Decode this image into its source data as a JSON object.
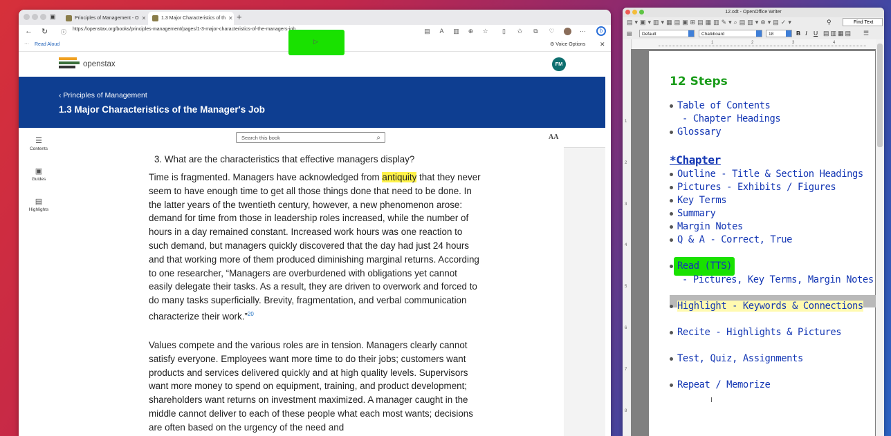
{
  "browser": {
    "tabs": [
      {
        "label": "Principles of Management - O"
      },
      {
        "label": "1.3 Major Characteristics of th"
      }
    ],
    "url": "https://openstax.org/books/principles-management/pages/1-3-major-characteristics-of-the-managers-job",
    "read_aloud": "Read Aloud",
    "voice_options": "Voice Options",
    "logo_text": "openstax",
    "avatar": "FM",
    "breadcrumb": "Principles of Management",
    "page_title": "1.3 Major Characteristics of the Manager's Job",
    "nav": [
      "Contents",
      "Guides",
      "Highlights"
    ],
    "search_placeholder": "Search this book",
    "font_size_icon": "AA",
    "question": "3. What are the characteristics that effective managers display?",
    "para1_a": "Time is fragmented. Managers have acknowledged from ",
    "para1_hl": "antiquity",
    "para1_b": " that they never seem to have enough time to get all those things done that need to be done. In the latter years of the twentieth century, however, a new phenomenon arose: demand for time from those in leadership roles increased, while the number of hours in a day remained constant. Increased work hours was one reaction to such demand, but managers quickly discovered that the day had just 24 hours and that working more of them produced diminishing marginal returns. According to one researcher, “Managers are overburdened with obligations yet cannot easily delegate their tasks. As a result, they are driven to overwork and forced to do many tasks superficially. Brevity, fragmentation, and verbal communication characterize their work.”",
    "para1_ref": "20",
    "para2": "Values compete and the various roles are in tension. Managers clearly cannot satisfy everyone. Employees want more time to do their jobs; customers want products and services delivered quickly and at high quality levels. Supervisors want more money to spend on equipment, training, and product development; shareholders want returns on investment maximized. A manager caught in the middle cannot deliver to each of these people what each most wants; decisions are often based on the urgency of the need and"
  },
  "writer": {
    "window_title": "12.odt - OpenOffice Writer",
    "find_text": "Find Text",
    "style": "Default",
    "font": "Chalkboard",
    "size": "18",
    "ruler_marks": [
      "1",
      "2",
      "3",
      "4"
    ],
    "vruler_marks": [
      "1",
      "2",
      "3",
      "4",
      "5",
      "6",
      "7",
      "8"
    ],
    "heading": "12 Steps",
    "lines": [
      "Table of Contents",
      "- Chapter Headings",
      "Glossary",
      "*Chapter",
      "Outline - Title & Section Headings",
      "Pictures - Exhibits / Figures",
      "Key Terms",
      "Summary",
      "Margin Notes",
      "Q & A - Correct, True",
      "Read (TTS)",
      "- Pictures, Key Terms, Margin Notes",
      "Highlight - Keywords & Connections",
      "Recite - Highlights & Pictures",
      "Test, Quiz, Assignments",
      "Repeat / Memorize"
    ],
    "cursor": "I"
  },
  "colors": {
    "banner": "#0e3e91",
    "green_highlight": "#19e100",
    "yellow_highlight": "#fff34a",
    "writer_text": "#1437b4",
    "writer_heading": "#1a9c1a"
  }
}
